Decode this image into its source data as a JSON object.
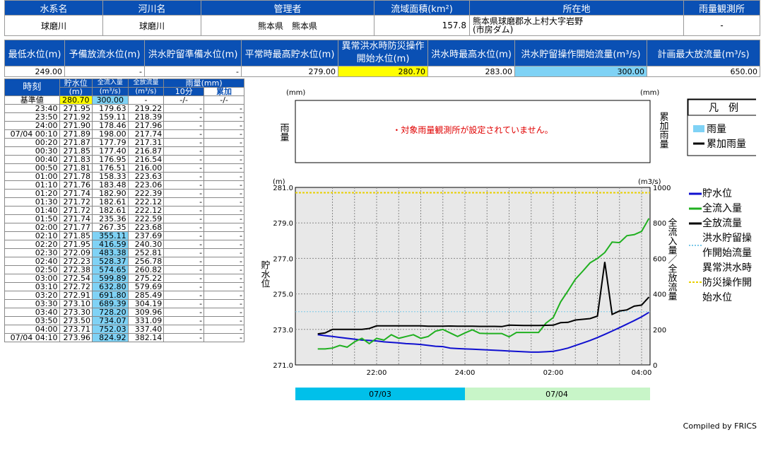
{
  "info": {
    "headers": [
      "水系名",
      "河川名",
      "管理者",
      "流域面積(km²)",
      "所在地",
      "雨量観測所"
    ],
    "values": [
      "球磨川",
      "球磨川",
      "熊本県　熊本県",
      "157.8",
      "熊本県球磨郡水上村大字岩野\n(市房ダム)",
      "-"
    ]
  },
  "levels": {
    "headers": [
      "最低水位(m)",
      "予備放流水位(m)",
      "洪水貯留準備水位(m)",
      "平常時最高貯水位(m)",
      "異常洪水時防災操作開始水位(m)",
      "洪水時最高水位(m)",
      "洪水貯留操作開始流量(m³/s)",
      "計画最大放流量(m³/s)"
    ],
    "values": [
      "249.00",
      "-",
      "-",
      "279.00",
      "280.70",
      "283.00",
      "300.00",
      "650.00"
    ]
  },
  "table": {
    "headers": {
      "time": "時刻",
      "level": "貯水位",
      "level_unit": "(m)",
      "inflow": "全流入量",
      "inflow_unit": "(m³/s)",
      "outflow": "全放流量",
      "outflow_unit": "(m³/s)",
      "rain": "雨量(mm)",
      "rain10": "10分",
      "raincum": "累加"
    },
    "base": {
      "label": "基準値",
      "level": "280.70",
      "inflow": "300.00",
      "outflow": "-",
      "rain10": "-/-",
      "raincum": "-/-"
    },
    "rows": [
      [
        "23:40",
        "271.95",
        "179.63",
        "219.22",
        "-",
        "-"
      ],
      [
        "23:50",
        "271.92",
        "159.11",
        "218.39",
        "-",
        "-"
      ],
      [
        "24:00",
        "271.90",
        "178.46",
        "217.96",
        "-",
        "-"
      ],
      [
        "07/04 00:10",
        "271.89",
        "198.00",
        "217.74",
        "-",
        "-"
      ],
      [
        "00:20",
        "271.87",
        "177.79",
        "217.31",
        "-",
        "-"
      ],
      [
        "00:30",
        "271.85",
        "177.40",
        "216.87",
        "-",
        "-"
      ],
      [
        "00:40",
        "271.83",
        "176.95",
        "216.54",
        "-",
        "-"
      ],
      [
        "00:50",
        "271.81",
        "176.51",
        "216.00",
        "-",
        "-"
      ],
      [
        "01:00",
        "271.78",
        "158.33",
        "223.63",
        "-",
        "-"
      ],
      [
        "01:10",
        "271.76",
        "183.48",
        "223.06",
        "-",
        "-"
      ],
      [
        "01:20",
        "271.74",
        "182.90",
        "222.39",
        "-",
        "-"
      ],
      [
        "01:30",
        "271.72",
        "182.61",
        "222.12",
        "-",
        "-"
      ],
      [
        "01:40",
        "271.72",
        "182.61",
        "222.12",
        "-",
        "-"
      ],
      [
        "01:50",
        "271.74",
        "235.36",
        "222.59",
        "-",
        "-"
      ],
      [
        "02:00",
        "271.77",
        "267.35",
        "223.68",
        "-",
        "-"
      ],
      [
        "02:10",
        "271.85",
        "355.11",
        "237.69",
        "-",
        "-"
      ],
      [
        "02:20",
        "271.95",
        "416.59",
        "240.30",
        "-",
        "-"
      ],
      [
        "02:30",
        "272.09",
        "483.38",
        "252.81",
        "-",
        "-"
      ],
      [
        "02:40",
        "272.23",
        "528.37",
        "256.78",
        "-",
        "-"
      ],
      [
        "02:50",
        "272.38",
        "574.65",
        "260.82",
        "-",
        "-"
      ],
      [
        "03:00",
        "272.54",
        "599.89",
        "275.22",
        "-",
        "-"
      ],
      [
        "03:10",
        "272.72",
        "632.80",
        "579.69",
        "-",
        "-"
      ],
      [
        "03:20",
        "272.91",
        "691.80",
        "285.49",
        "-",
        "-"
      ],
      [
        "03:30",
        "273.10",
        "689.39",
        "304.19",
        "-",
        "-"
      ],
      [
        "03:40",
        "273.30",
        "728.20",
        "309.96",
        "-",
        "-"
      ],
      [
        "03:50",
        "273.50",
        "734.07",
        "331.09",
        "-",
        "-"
      ],
      [
        "04:00",
        "273.71",
        "752.03",
        "337.40",
        "-",
        "-"
      ],
      [
        "07/04 04:10",
        "273.96",
        "824.92",
        "382.14",
        "-",
        "-"
      ]
    ]
  },
  "rain_chart": {
    "unit_left": "(mm)",
    "unit_right": "(mm)",
    "left_label": "雨量",
    "right_label": "累加雨量",
    "message": "・対象雨量観測所が設定されていません。"
  },
  "legend_rain": {
    "title": "凡　例",
    "items": [
      "雨量",
      "累加雨量"
    ]
  },
  "legend_main": {
    "items": [
      "貯水位",
      "全流入量",
      "全放流量",
      "洪水貯留操作開始流量",
      "異常洪水時防災操作開始水位"
    ]
  },
  "chart_data": {
    "type": "line",
    "ylabel_left": "貯水位",
    "ylabel_right": "全流入量／全放流量",
    "unit_left": "(m)",
    "unit_right": "(m3/s)",
    "ylim_left": [
      271.0,
      281.0
    ],
    "ylim_right": [
      0,
      1000
    ],
    "yticks_left": [
      "271.0",
      "273.0",
      "275.0",
      "277.0",
      "279.0",
      "281.0"
    ],
    "yticks_right": [
      "0",
      "200",
      "400",
      "600",
      "800",
      "1000"
    ],
    "xticks": [
      "22:00",
      "24:00",
      "02:00",
      "04:00"
    ],
    "dates": [
      "07/03",
      "07/04"
    ],
    "x": [
      "20:40",
      "20:50",
      "21:00",
      "21:10",
      "21:20",
      "21:30",
      "21:40",
      "21:50",
      "22:00",
      "22:10",
      "22:20",
      "22:30",
      "22:40",
      "22:50",
      "23:00",
      "23:10",
      "23:20",
      "23:30",
      "23:40",
      "23:50",
      "24:00",
      "00:10",
      "00:20",
      "00:30",
      "00:40",
      "00:50",
      "01:00",
      "01:10",
      "01:20",
      "01:30",
      "01:40",
      "01:50",
      "02:00",
      "02:10",
      "02:20",
      "02:30",
      "02:40",
      "02:50",
      "03:00",
      "03:10",
      "03:20",
      "03:30",
      "03:40",
      "03:50",
      "04:00",
      "04:10"
    ],
    "series": [
      {
        "name": "貯水位",
        "axis": "left",
        "color": "#1010d0",
        "values": [
          272.7,
          272.65,
          272.6,
          272.55,
          272.5,
          272.45,
          272.4,
          272.38,
          272.35,
          272.3,
          272.27,
          272.24,
          272.2,
          272.18,
          272.15,
          272.1,
          272.05,
          272.03,
          271.95,
          271.92,
          271.9,
          271.89,
          271.87,
          271.85,
          271.83,
          271.81,
          271.78,
          271.76,
          271.74,
          271.72,
          271.72,
          271.74,
          271.77,
          271.85,
          271.95,
          272.09,
          272.23,
          272.38,
          272.54,
          272.72,
          272.91,
          273.1,
          273.3,
          273.5,
          273.71,
          273.96
        ]
      },
      {
        "name": "全流入量",
        "axis": "right",
        "color": "#20b020",
        "values": [
          90,
          90,
          95,
          110,
          100,
          130,
          150,
          120,
          150,
          140,
          170,
          150,
          160,
          170,
          150,
          160,
          190,
          200,
          180,
          160,
          180,
          198,
          178,
          177,
          177,
          177,
          158,
          183,
          183,
          183,
          183,
          235,
          267,
          355,
          417,
          483,
          528,
          575,
          600,
          633,
          692,
          689,
          728,
          734,
          752,
          825
        ]
      },
      {
        "name": "全放流量",
        "axis": "right",
        "color": "#000000",
        "values": [
          175,
          180,
          200,
          200,
          200,
          200,
          200,
          205,
          220,
          220,
          220,
          220,
          220,
          220,
          220,
          218,
          218,
          218,
          219,
          218,
          218,
          218,
          217,
          217,
          217,
          216,
          224,
          223,
          222,
          222,
          222,
          223,
          224,
          238,
          240,
          253,
          257,
          261,
          275,
          580,
          285,
          304,
          310,
          331,
          337,
          382
        ]
      }
    ],
    "threshold_flow": {
      "name": "洪水貯留操作開始流量",
      "value": 300,
      "color": "#7ac8e8"
    },
    "threshold_level": {
      "name": "異常洪水時防災操作開始水位",
      "value": 280.7,
      "color": "#e8d000"
    }
  },
  "credit": "Compiled by FRICS"
}
